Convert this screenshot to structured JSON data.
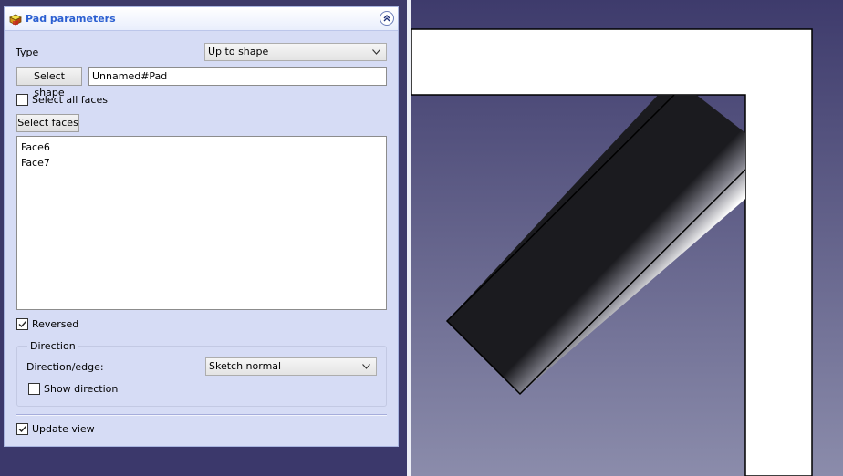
{
  "panel": {
    "title": "Pad parameters",
    "type_label": "Type",
    "type_value": "Up to shape",
    "select_shape_label": "Select shape",
    "shape_value": "Unnamed#Pad",
    "select_all_faces_label": "Select all faces",
    "select_all_faces_checked": false,
    "select_faces_label": "Select faces",
    "faces": [
      "Face6",
      "Face7"
    ],
    "reversed_label": "Reversed",
    "reversed_checked": true,
    "direction": {
      "group_title": "Direction",
      "edge_label": "Direction/edge:",
      "edge_value": "Sketch normal",
      "show_direction_label": "Show direction",
      "show_direction_checked": false
    },
    "update_view_label": "Update view",
    "update_view_checked": true
  },
  "colors": {
    "panel_bg": "#d6dcf5",
    "title_text": "#2b5fd1",
    "viewport_top": "#3e3b6c",
    "viewport_bottom": "#8b8cab",
    "frame_white": "#ffffff"
  },
  "icons": {
    "task": "pad-feature-icon",
    "collapse": "double-chevron-up-icon",
    "dropdown": "chevron-down-icon",
    "check": "checkmark-icon"
  }
}
